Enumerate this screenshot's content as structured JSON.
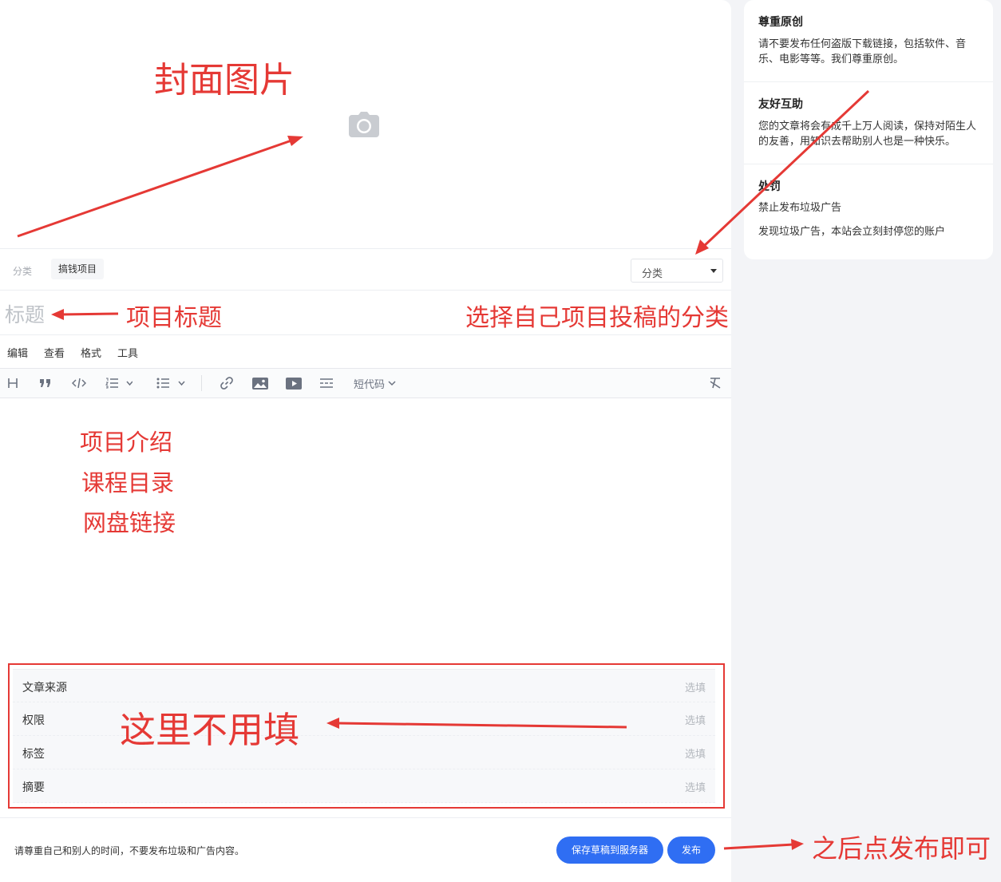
{
  "editor": {
    "category": {
      "label": "分类",
      "chip": "搞钱项目",
      "select_value": "分类"
    },
    "title_placeholder": "标题",
    "menu": [
      "编辑",
      "查看",
      "格式",
      "工具"
    ],
    "toolbar": {
      "icons": [
        "heading-icon",
        "quote-icon",
        "code-icon",
        "ordered-list-icon",
        "bullet-list-icon",
        "link-icon",
        "image-icon",
        "video-icon",
        "divider-icon",
        "clear-format-icon"
      ],
      "shortcode_label": "短代码"
    },
    "meta_fields": [
      {
        "label": "文章来源",
        "hint": "选填"
      },
      {
        "label": "权限",
        "hint": "选填"
      },
      {
        "label": "标签",
        "hint": "选填"
      },
      {
        "label": "摘要",
        "hint": "选填"
      }
    ],
    "footer_note": "请尊重自己和别人的时间，不要发布垃圾和广告内容。",
    "save_draft_label": "保存草稿到服务器",
    "publish_label": "发布"
  },
  "sidebar": {
    "rules": [
      {
        "title": "尊重原创",
        "texts": [
          "请不要发布任何盗版下载链接，包括软件、音乐、电影等等。我们尊重原创。"
        ]
      },
      {
        "title": "友好互助",
        "texts": [
          "您的文章将会有成千上万人阅读，保持对陌生人的友善，用知识去帮助别人也是一种快乐。"
        ]
      },
      {
        "title": "处罚",
        "texts": [
          "禁止发布垃圾广告",
          "发现垃圾广告，本站会立刻封停您的账户"
        ]
      }
    ]
  },
  "annotations": {
    "cover": "封面图片",
    "title": "项目标题",
    "category": "选择自己项目投稿的分类",
    "content_lines": [
      "项目介绍",
      "课程目录",
      "网盘链接"
    ],
    "meta": "这里不用填",
    "publish": "之后点发布即可"
  },
  "colors": {
    "accent": "#2f6ef3",
    "annotation": "#e53935"
  }
}
